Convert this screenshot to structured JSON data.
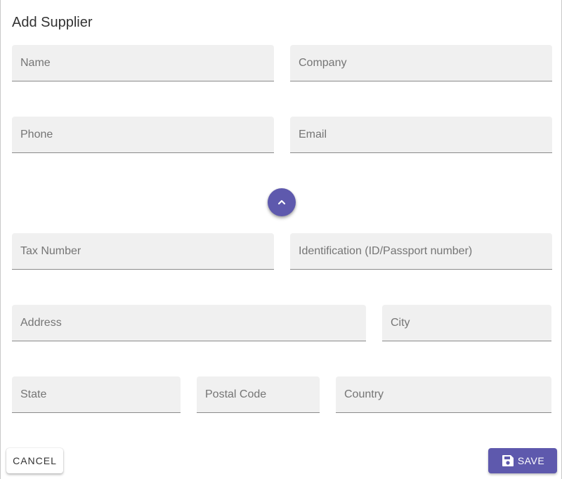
{
  "dialog": {
    "title": "Add Supplier"
  },
  "fields": {
    "name": {
      "placeholder": "Name",
      "value": ""
    },
    "company": {
      "placeholder": "Company",
      "value": ""
    },
    "phone": {
      "placeholder": "Phone",
      "value": ""
    },
    "email": {
      "placeholder": "Email",
      "value": ""
    },
    "tax_number": {
      "placeholder": "Tax Number",
      "value": ""
    },
    "identification": {
      "placeholder": "Identification (ID/Passport number)",
      "value": ""
    },
    "address": {
      "placeholder": "Address",
      "value": ""
    },
    "city": {
      "placeholder": "City",
      "value": ""
    },
    "state": {
      "placeholder": "State",
      "value": ""
    },
    "postal_code": {
      "placeholder": "Postal Code",
      "value": ""
    },
    "country": {
      "placeholder": "Country",
      "value": ""
    }
  },
  "actions": {
    "cancel_label": "CANCEL",
    "save_label": "SAVE",
    "collapse_icon": "chevron-up-icon",
    "save_icon": "floppy-disk-icon"
  },
  "colors": {
    "primary": "#5e59ad",
    "field_bg": "#f0f0f0",
    "placeholder": "#757575"
  }
}
